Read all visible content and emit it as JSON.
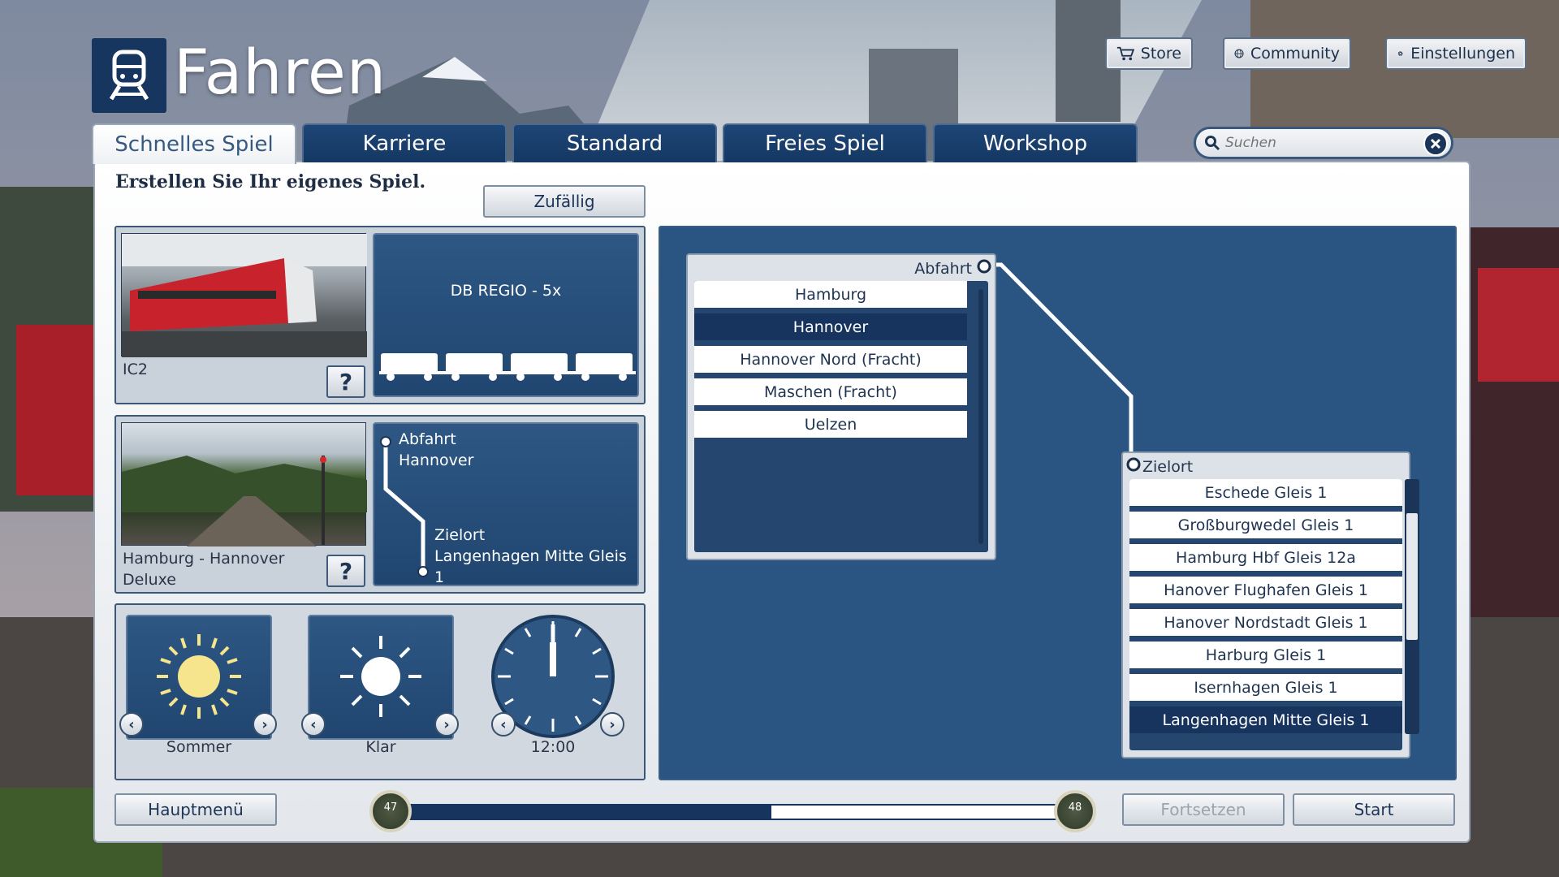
{
  "header": {
    "title": "Fahren",
    "store_label": "Store",
    "community_label": "Community",
    "settings_label": "Einstellungen"
  },
  "tabs": [
    {
      "label": "Schnelles Spiel",
      "active": true
    },
    {
      "label": "Karriere",
      "active": false
    },
    {
      "label": "Standard",
      "active": false
    },
    {
      "label": "Freies Spiel",
      "active": false
    },
    {
      "label": "Workshop",
      "active": false
    }
  ],
  "search": {
    "placeholder": "Suchen"
  },
  "main": {
    "subtitle": "Erstellen Sie Ihr eigenes Spiel.",
    "random_label": "Zufällig"
  },
  "train": {
    "name": "IC2",
    "consist": "DB REGIO - 5x",
    "help": "?"
  },
  "route": {
    "name_line1": "Hamburg - Hannover",
    "name_line2": "Deluxe",
    "help": "?",
    "departure_label": "Abfahrt",
    "departure_value": "Hannover",
    "destination_label": "Zielort",
    "destination_value": "Langenhagen Mitte Gleis 1"
  },
  "weather": {
    "season": "Sommer",
    "condition": "Klar",
    "time": "12:00"
  },
  "departure_list": {
    "header": "Abfahrt",
    "items": [
      "Hamburg",
      "Hannover",
      "Hannover Nord (Fracht)",
      "Maschen (Fracht)",
      "Uelzen"
    ],
    "selected_index": 1
  },
  "destination_list": {
    "header": "Zielort",
    "items": [
      "Eschede Gleis 1",
      "Großburgwedel Gleis 1",
      "Hamburg Hbf Gleis 12a",
      "Hanover Flughafen Gleis 1",
      "Hanover Nordstadt Gleis 1",
      "Harburg Gleis 1",
      "Isernhagen Gleis 1",
      "Langenhagen Mitte Gleis 1"
    ],
    "selected_index": 7
  },
  "footer": {
    "main_menu_label": "Hauptmenü",
    "continue_label": "Fortsetzen",
    "start_label": "Start",
    "progress_left": "47",
    "progress_right": "48",
    "progress_fraction": 0.56
  },
  "colors": {
    "accent_dark_blue": "#17345e",
    "panel_blue": "#2a5481",
    "sun_yellow": "#f6e58d"
  }
}
